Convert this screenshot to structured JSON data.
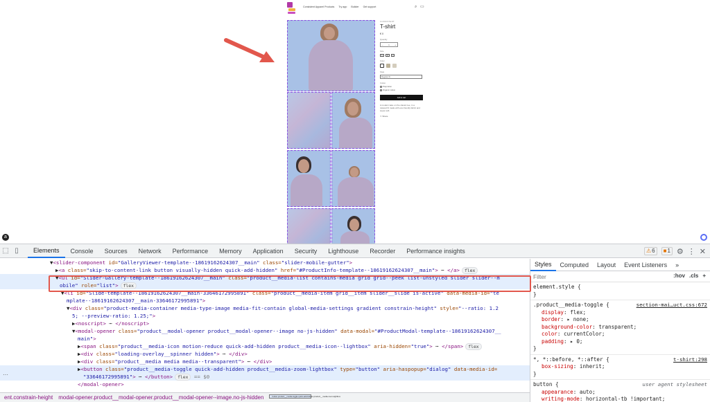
{
  "store": {
    "nav": [
      "Consistent Apparel Products",
      "Try app",
      "Builder",
      "Get support"
    ],
    "product": {
      "brand": "CONSISTENT",
      "title": "T-shirt",
      "price": "€ 0",
      "quantity_label": "Quantity",
      "quantity_value": "1",
      "size_label": "Size",
      "sizes": [
        "S",
        "M",
        "L"
      ],
      "color_label": "Color",
      "style_label": "Style",
      "style_value": "Regular fit",
      "cotton_label": "Cotton",
      "cotton_options": [
        "Polycotton",
        "Organic cotton"
      ],
      "add_to_cart": "Add to cart",
      "description": "A modern take on the classic tee, in a relaxed fit made with eco-friendly fabric and super-soft.",
      "share": "Share"
    }
  },
  "devtools": {
    "tabs": [
      "Elements",
      "Console",
      "Sources",
      "Network",
      "Performance",
      "Memory",
      "Application",
      "Security",
      "Lighthouse",
      "Recorder",
      "Performance insights"
    ],
    "warnings": "6",
    "issues": "1",
    "elements": [
      {
        "indent": 72,
        "parts": [
          [
            "tx",
            "▼"
          ],
          [
            "tn",
            "<slider-component"
          ],
          [
            "at",
            " id="
          ],
          [
            "av",
            "\"GalleryViewer-template--18619162624307__main\""
          ],
          [
            "at",
            " class="
          ],
          [
            "av",
            "\"slider-mobile-gutter\""
          ],
          [
            "tn",
            ">"
          ]
        ]
      },
      {
        "indent": 80,
        "parts": [
          [
            "tx",
            "▶"
          ],
          [
            "tn",
            "<a"
          ],
          [
            "at",
            " class="
          ],
          [
            "av",
            "\"skip-to-content-link button visually-hidden quick-add-hidden\""
          ],
          [
            "at",
            " href="
          ],
          [
            "av",
            "\"#ProductInfo-template--18619162624307__main\""
          ],
          [
            "tn",
            ">"
          ],
          [
            "tx",
            " ⋯ "
          ],
          [
            "tn",
            "</a>"
          ]
        ],
        "pill": "flex"
      },
      {
        "indent": 80,
        "parts": [
          [
            "tx",
            "▼"
          ],
          [
            "tn",
            "<ul"
          ],
          [
            "at",
            " id="
          ],
          [
            "av",
            "\"Slider-Gallery-template--18619162624307__main\""
          ],
          [
            "at",
            " class="
          ],
          [
            "av",
            "\"product__media-list contains-media grid grid--peek list-unstyled slider slider--m"
          ]
        ],
        "hl": true
      },
      {
        "indent": 86,
        "parts": [
          [
            "av",
            "obile\""
          ],
          [
            "at",
            " role="
          ],
          [
            "av",
            "\"list\""
          ],
          [
            "tn",
            ">"
          ]
        ],
        "pill": "flex",
        "hl": true
      },
      {
        "indent": 88,
        "parts": [
          [
            "tx",
            "▼"
          ],
          [
            "tn",
            "<li"
          ],
          [
            "at",
            " id="
          ],
          [
            "av",
            "\"Slide-template--18619162624307__main-33646172995891\""
          ],
          [
            "at",
            " class="
          ],
          [
            "av",
            "\"product__media-item grid__item slider__slide is-active\""
          ],
          [
            "at",
            " data-media-id="
          ],
          [
            "av",
            "\"te"
          ]
        ]
      },
      {
        "indent": 96,
        "parts": [
          [
            "av",
            "mplate--18619162624307__main-33646172995891\""
          ],
          [
            "tn",
            ">"
          ]
        ]
      },
      {
        "indent": 96,
        "parts": [
          [
            "tx",
            "▼"
          ],
          [
            "tn",
            "<div"
          ],
          [
            "at",
            " class="
          ],
          [
            "av",
            "\"product-media-container media-type-image media-fit-contain global-media-settings gradient constrain-height\""
          ],
          [
            "at",
            " style="
          ],
          [
            "av",
            "\"--ratio: 1.2"
          ]
        ]
      },
      {
        "indent": 104,
        "parts": [
          [
            "av",
            "5; --preview-ratio: 1.25;\""
          ],
          [
            "tn",
            ">"
          ]
        ]
      },
      {
        "indent": 104,
        "parts": [
          [
            "tx",
            "▶"
          ],
          [
            "tn",
            "<noscript>"
          ],
          [
            "tx",
            " ⋯ "
          ],
          [
            "tn",
            "</noscript>"
          ]
        ]
      },
      {
        "indent": 104,
        "parts": [
          [
            "tx",
            "▼"
          ],
          [
            "tn",
            "<modal-opener"
          ],
          [
            "at",
            " class="
          ],
          [
            "av",
            "\"product__modal-opener product__modal-opener--image no-js-hidden\""
          ],
          [
            "at",
            " data-modal="
          ],
          [
            "av",
            "\"#ProductModal-template--18619162624307__"
          ]
        ]
      },
      {
        "indent": 112,
        "parts": [
          [
            "av",
            "main\""
          ],
          [
            "tn",
            ">"
          ]
        ]
      },
      {
        "indent": 112,
        "parts": [
          [
            "tx",
            "▶"
          ],
          [
            "tn",
            "<span"
          ],
          [
            "at",
            " class="
          ],
          [
            "av",
            "\"product__media-icon motion-reduce quick-add-hidden product__media-icon--lightbox\""
          ],
          [
            "at",
            " aria-hidden="
          ],
          [
            "av",
            "\"true\""
          ],
          [
            "tn",
            ">"
          ],
          [
            "tx",
            " ⋯ "
          ],
          [
            "tn",
            "</span>"
          ]
        ],
        "pill": "flex"
      },
      {
        "indent": 112,
        "parts": [
          [
            "tx",
            "▶"
          ],
          [
            "tn",
            "<div"
          ],
          [
            "at",
            " class="
          ],
          [
            "av",
            "\"loading-overlay__spinner hidden\""
          ],
          [
            "tn",
            ">"
          ],
          [
            "tx",
            " ⋯ "
          ],
          [
            "tn",
            "</div>"
          ]
        ]
      },
      {
        "indent": 112,
        "parts": [
          [
            "tx",
            "▶"
          ],
          [
            "tn",
            "<div"
          ],
          [
            "at",
            " class="
          ],
          [
            "av",
            "\"product__media media media--transparent\""
          ],
          [
            "tn",
            ">"
          ],
          [
            "tx",
            " ⋯ "
          ],
          [
            "tn",
            "</div>"
          ]
        ]
      },
      {
        "indent": 112,
        "parts": [
          [
            "tx",
            "▶"
          ],
          [
            "tn",
            "<button"
          ],
          [
            "at",
            " class="
          ],
          [
            "av",
            "\"product__media-toggle quick-add-hidden product__media-zoom-lightbox\""
          ],
          [
            "at",
            " type="
          ],
          [
            "av",
            "\"button\""
          ],
          [
            "at",
            " aria-haspopup="
          ],
          [
            "av",
            "\"dialog\""
          ],
          [
            "at",
            " data-media-id="
          ]
        ],
        "sel": true
      },
      {
        "indent": 120,
        "parts": [
          [
            "av",
            "\"33646172995891\""
          ],
          [
            "tn",
            ">"
          ],
          [
            "tx",
            " ⋯ "
          ],
          [
            "tn",
            "</button>"
          ]
        ],
        "pill": "flex",
        "tail": " == $0",
        "sel": true
      },
      {
        "indent": 112,
        "parts": [
          [
            "tn",
            "</modal-opener>"
          ]
        ]
      }
    ],
    "breadcrumbs": [
      "ent.constrain-height",
      "modal-opener.product__modal-opener.product__modal-opener--image.no-js-hidden",
      "button.product__media-toggle.quick-add-hidden.product__media-zoom-lightbox"
    ],
    "styles_tabs": [
      "Styles",
      "Computed",
      "Layout",
      "Event Listeners",
      "»"
    ],
    "filter_placeholder": "Filter",
    "filter_tools": [
      ":hov",
      ".cls",
      "+"
    ],
    "rules": [
      {
        "selector": "element.style {",
        "props": [],
        "close": "}",
        "src": ""
      },
      {
        "selector": ".product__media-toggle {",
        "src": "section-mai…uct.css:672",
        "props": [
          [
            "display",
            "flex;"
          ],
          [
            "border",
            "▸ none;"
          ],
          [
            "background-color",
            "transparent;"
          ],
          [
            "color",
            "currentColor;"
          ],
          [
            "padding",
            "▸ 0;"
          ]
        ],
        "close": "}"
      },
      {
        "selector": "*, *::before, *::after {",
        "src": "t-shirt:298",
        "props": [
          [
            "box-sizing",
            "inherit;"
          ]
        ],
        "close": "}"
      },
      {
        "selector": "button {",
        "src": "user agent stylesheet",
        "ua": true,
        "props": [
          [
            "appearance",
            "auto;"
          ],
          [
            "writing-mode",
            "horizontal-tb !important;"
          ]
        ],
        "close": ""
      }
    ]
  }
}
